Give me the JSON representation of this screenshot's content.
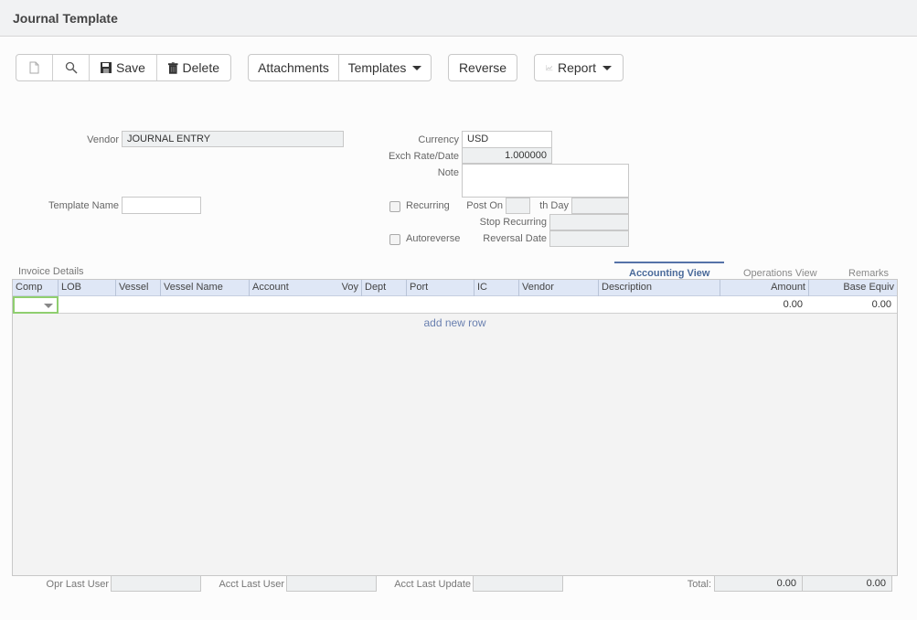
{
  "header": {
    "title": "Journal Template"
  },
  "toolbar": {
    "new_icon": "new-document-icon",
    "search_icon": "search-icon",
    "save_label": "Save",
    "delete_label": "Delete",
    "attachments_label": "Attachments",
    "templates_label": "Templates",
    "reverse_label": "Reverse",
    "report_label": "Report"
  },
  "form": {
    "vendor_label": "Vendor",
    "vendor_value": "JOURNAL ENTRY",
    "template_name_label": "Template Name",
    "template_name_value": "",
    "currency_label": "Currency",
    "currency_value": "USD",
    "exch_rate_label": "Exch Rate/Date",
    "exch_rate_value": "1.000000",
    "note_label": "Note",
    "note_value": "",
    "recurring_label": "Recurring",
    "recurring_checked": false,
    "post_on_label": "Post On",
    "th_day_label": "th Day",
    "stop_recurring_label": "Stop Recurring",
    "autoreverse_label": "Autoreverse",
    "autoreverse_checked": false,
    "reversal_date_label": "Reversal Date"
  },
  "details": {
    "section_label": "Invoice Details",
    "tabs": [
      {
        "label": "Accounting View",
        "active": true
      },
      {
        "label": "Operations View",
        "active": false
      },
      {
        "label": "Remarks",
        "active": false
      }
    ],
    "columns": [
      "Comp",
      "LOB",
      "Vessel",
      "Vessel Name",
      "Account",
      "Voy",
      "Dept",
      "Port",
      "IC",
      "Vendor",
      "Description",
      "Amount",
      "Base Equiv"
    ],
    "rows": [
      {
        "comp": "",
        "amount": "0.00",
        "base_equiv": "0.00"
      }
    ],
    "add_row_label": "add new row"
  },
  "footer": {
    "opr_last_user_label": "Opr Last User",
    "opr_last_user_value": "",
    "acct_last_user_label": "Acct Last User",
    "acct_last_user_value": "",
    "acct_last_update_label": "Acct Last Update",
    "acct_last_update_value": "",
    "total_label": "Total:",
    "total_amount": "0.00",
    "total_base_equiv": "0.00"
  }
}
